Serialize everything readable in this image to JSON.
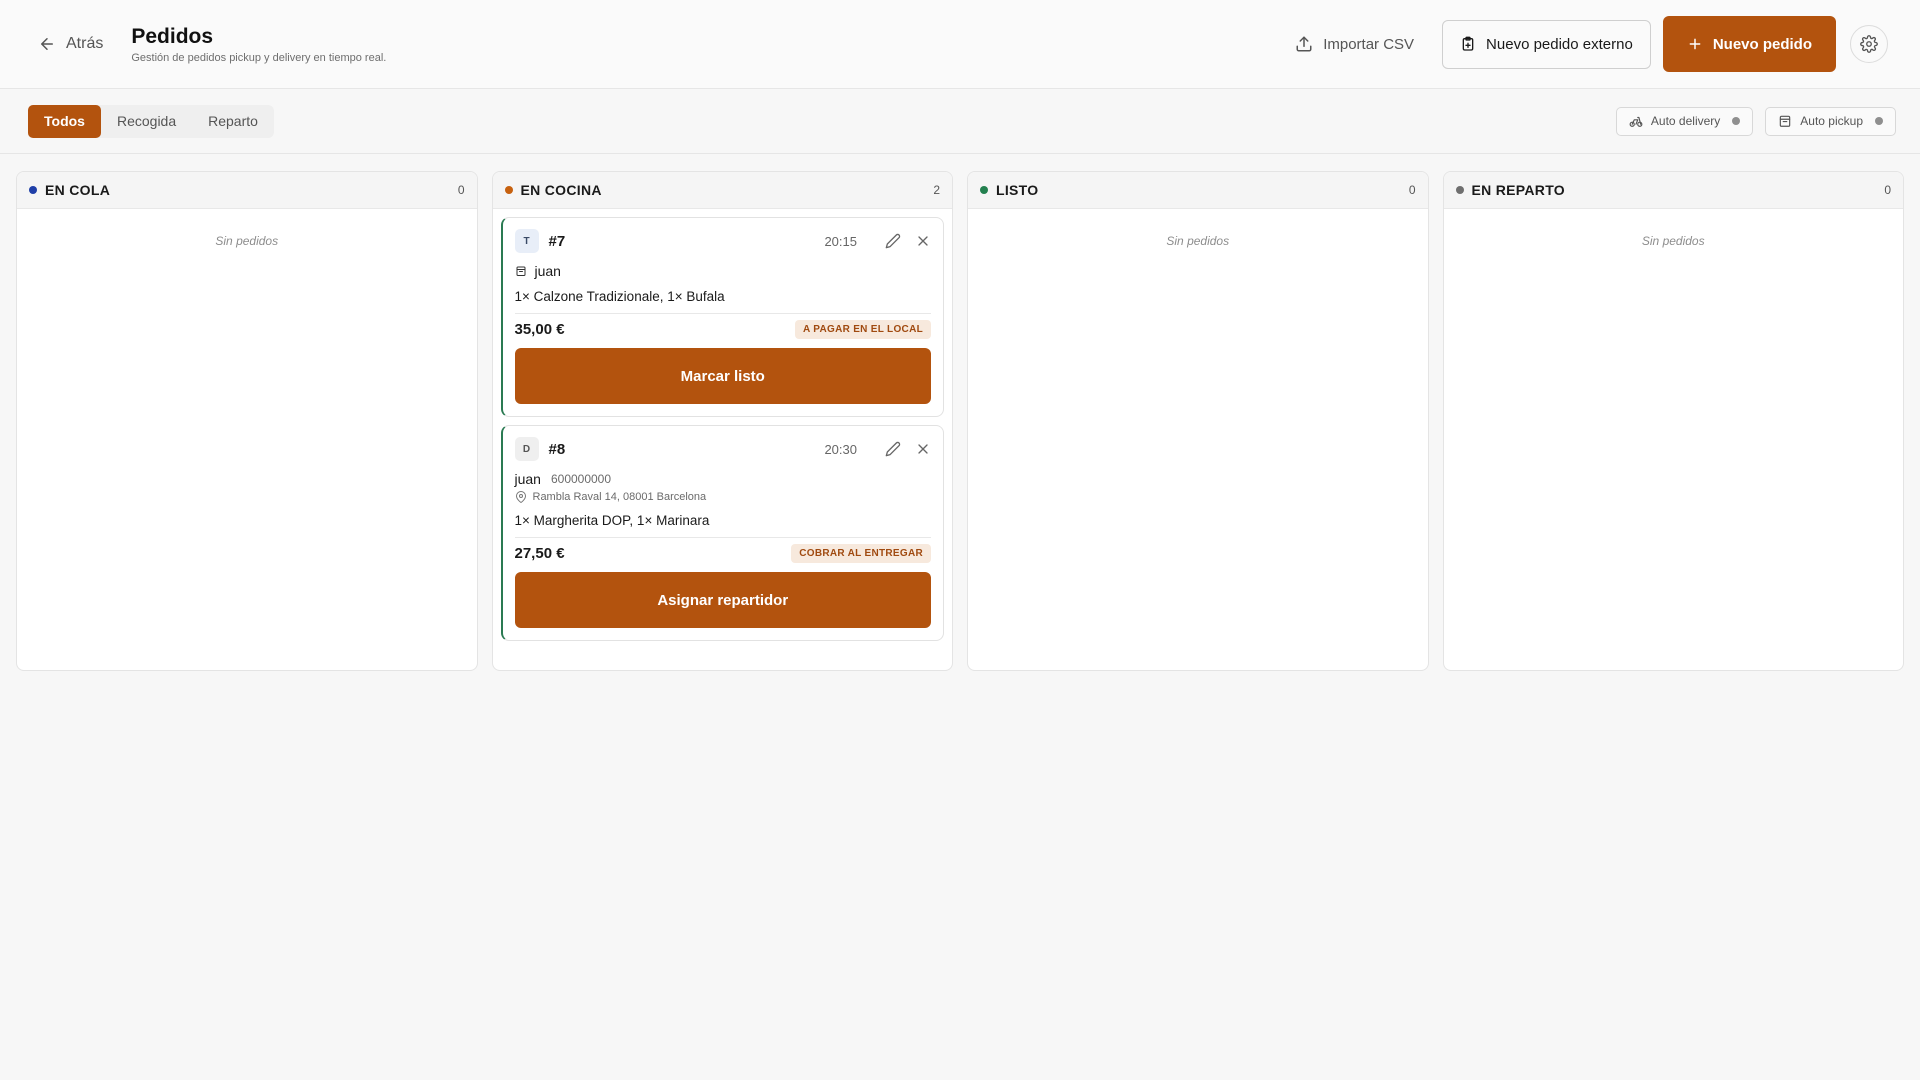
{
  "header": {
    "back_label": "Atrás",
    "title": "Pedidos",
    "subtitle": "Gestión de pedidos pickup y delivery en tiempo real.",
    "import_label": "Importar CSV",
    "external_label": "Nuevo pedido externo",
    "new_label": "Nuevo pedido"
  },
  "tabs": [
    "Todos",
    "Recogida",
    "Reparto"
  ],
  "toggles": {
    "delivery_label": "Auto delivery",
    "pickup_label": "Auto pickup"
  },
  "colors": {
    "accent": "#b3530e",
    "queue": "#1f3fa8",
    "kitchen": "#c7610f",
    "ready": "#23804f",
    "delivery": "#6f6f6f"
  },
  "columns": [
    {
      "title": "EN COLA",
      "count": "0",
      "empty": "Sin pedidos"
    },
    {
      "title": "EN COCINA",
      "count": "2",
      "empty": ""
    },
    {
      "title": "LISTO",
      "count": "0",
      "empty": "Sin pedidos"
    },
    {
      "title": "EN REPARTO",
      "count": "0",
      "empty": "Sin pedidos"
    }
  ],
  "orders": [
    {
      "type_letter": "T",
      "number": "#7",
      "time": "20:15",
      "customer": "juan",
      "items": "1× Calzone Tradizionale, 1× Bufala",
      "price": "35,00 €",
      "payment": "A PAGAR EN EL LOCAL",
      "action": "Marcar listo"
    },
    {
      "type_letter": "D",
      "number": "#8",
      "time": "20:30",
      "customer": "juan",
      "phone": "600000000",
      "address": "Rambla Raval 14, 08001 Barcelona",
      "items": "1× Margherita DOP, 1× Marinara",
      "price": "27,50 €",
      "payment": "COBRAR AL ENTREGAR",
      "action": "Asignar repartidor"
    }
  ],
  "icons": [
    "arrow-left-icon",
    "upload-icon",
    "clipboard-icon",
    "plus-icon",
    "gear-icon",
    "bike-icon",
    "bag-icon",
    "pencil-icon",
    "close-icon",
    "map-pin-icon"
  ]
}
